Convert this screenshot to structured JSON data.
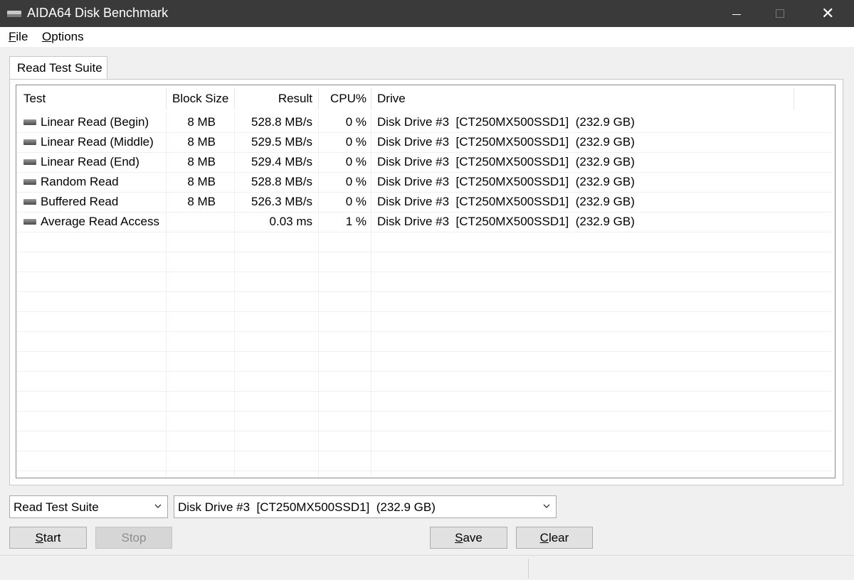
{
  "window": {
    "title": "AIDA64 Disk Benchmark",
    "close_glyph": "✕"
  },
  "menu": {
    "file": {
      "accel": "F",
      "rest": "ile"
    },
    "options": {
      "accel": "O",
      "rest": "ptions"
    }
  },
  "tab": {
    "label": "Read Test Suite"
  },
  "table": {
    "columns": {
      "test": "Test",
      "block_size": "Block Size",
      "result": "Result",
      "cpu": "CPU%",
      "drive": "Drive"
    },
    "rows": [
      {
        "test": "Linear Read (Begin)",
        "block_size": "8 MB",
        "result": "528.8 MB/s",
        "cpu": "0 %",
        "drive": "Disk Drive #3  [CT250MX500SSD1]  (232.9 GB)"
      },
      {
        "test": "Linear Read (Middle)",
        "block_size": "8 MB",
        "result": "529.5 MB/s",
        "cpu": "0 %",
        "drive": "Disk Drive #3  [CT250MX500SSD1]  (232.9 GB)"
      },
      {
        "test": "Linear Read (End)",
        "block_size": "8 MB",
        "result": "529.4 MB/s",
        "cpu": "0 %",
        "drive": "Disk Drive #3  [CT250MX500SSD1]  (232.9 GB)"
      },
      {
        "test": "Random Read",
        "block_size": "8 MB",
        "result": "528.8 MB/s",
        "cpu": "0 %",
        "drive": "Disk Drive #3  [CT250MX500SSD1]  (232.9 GB)"
      },
      {
        "test": "Buffered Read",
        "block_size": "8 MB",
        "result": "526.3 MB/s",
        "cpu": "0 %",
        "drive": "Disk Drive #3  [CT250MX500SSD1]  (232.9 GB)"
      },
      {
        "test": "Average Read Access",
        "block_size": "",
        "result": "0.03 ms",
        "cpu": "1 %",
        "drive": "Disk Drive #3  [CT250MX500SSD1]  (232.9 GB)"
      }
    ]
  },
  "controls": {
    "suite_select": "Read Test Suite",
    "drive_select": "Disk Drive #3  [CT250MX500SSD1]  (232.9 GB)",
    "start": {
      "accel": "S",
      "rest": "tart"
    },
    "stop": "Stop",
    "save": {
      "accel": "S",
      "rest": "ave"
    },
    "clear": {
      "accel": "C",
      "rest": "lear"
    }
  }
}
